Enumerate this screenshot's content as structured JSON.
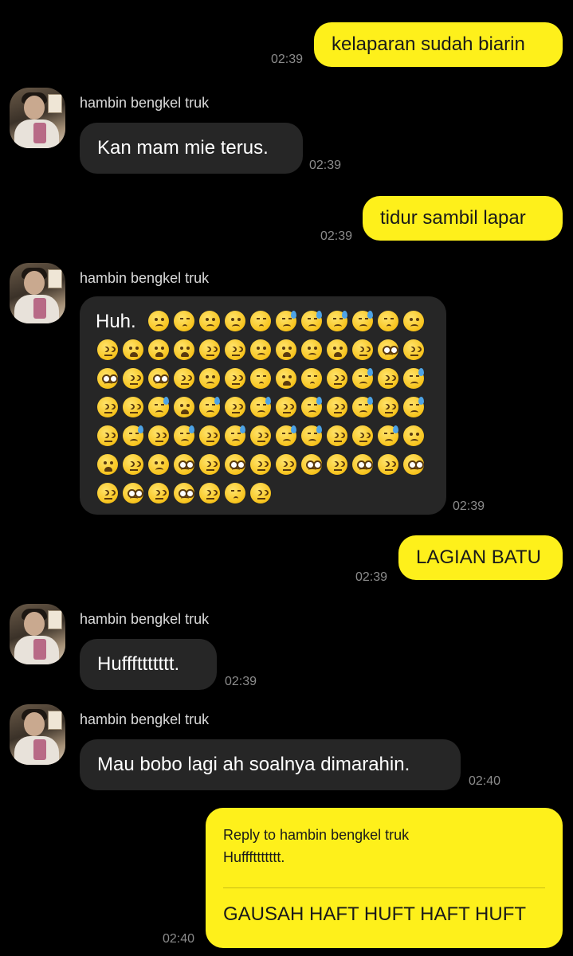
{
  "messages": [
    {
      "direction": "out",
      "text": "kelaparan sudah biarin",
      "time": "02:39"
    },
    {
      "direction": "in",
      "sender": "hambin bengkel truk",
      "text": "Kan mam mie terus.",
      "time": "02:39"
    },
    {
      "direction": "out",
      "text": "tidur sambil lapar",
      "time": "02:39"
    },
    {
      "direction": "in",
      "sender": "hambin bengkel truk",
      "text": "Huh.",
      "time": "02:39",
      "emoji": [
        "frowning",
        "pensive",
        "frowning",
        "frowning",
        "pensive",
        "downcast-sweat",
        "downcast-sweat",
        "downcast-sweat",
        "downcast-sweat",
        "pensive",
        "frowning",
        "confounded",
        "weary",
        "weary",
        "weary",
        "confounded",
        "confounded",
        "frowning",
        "weary",
        "frowning",
        "weary",
        "confounded",
        "pleading",
        "confounded",
        "pleading",
        "confounded",
        "pleading",
        "confounded",
        "frowning",
        "confounded",
        "pensive",
        "weary",
        "pensive",
        "confounded",
        "downcast-sweat",
        "confounded",
        "downcast-sweat",
        "confounded",
        "confounded",
        "downcast-sweat",
        "weary",
        "downcast-sweat",
        "confounded",
        "downcast-sweat",
        "confounded",
        "downcast-sweat",
        "confounded",
        "downcast-sweat",
        "confounded",
        "downcast-sweat",
        "confounded",
        "downcast-sweat",
        "confounded",
        "downcast-sweat",
        "confounded",
        "downcast-sweat",
        "confounded",
        "downcast-sweat",
        "downcast-sweat",
        "confounded",
        "confounded",
        "downcast-sweat",
        "frowning",
        "weary",
        "confounded",
        "frowning",
        "pleading",
        "confounded",
        "pleading",
        "confounded",
        "confounded",
        "pleading",
        "confounded",
        "pleading",
        "confounded",
        "pleading",
        "confounded",
        "pleading",
        "confounded",
        "pleading",
        "confounded",
        "pensive",
        "confounded"
      ]
    },
    {
      "direction": "out",
      "text": "LAGIAN BATU",
      "time": "02:39"
    },
    {
      "direction": "in",
      "sender": "hambin bengkel truk",
      "text": "Hufffttttttt.",
      "time": "02:39"
    },
    {
      "direction": "in",
      "sender": "hambin bengkel truk",
      "text": "Mau bobo lagi ah soalnya dimarahin.",
      "time": "02:40"
    },
    {
      "direction": "out",
      "reply_label": "Reply to hambin bengkel truk",
      "reply_quote": "Hufffttttttt.",
      "text": "GAUSAH HAFT HUFT HAFT HUFT",
      "time": "02:40"
    }
  ],
  "colors": {
    "background": "#000000",
    "outgoing_bubble": "#fef01b",
    "incoming_bubble": "#262626",
    "timestamp": "#8c8c8c"
  }
}
